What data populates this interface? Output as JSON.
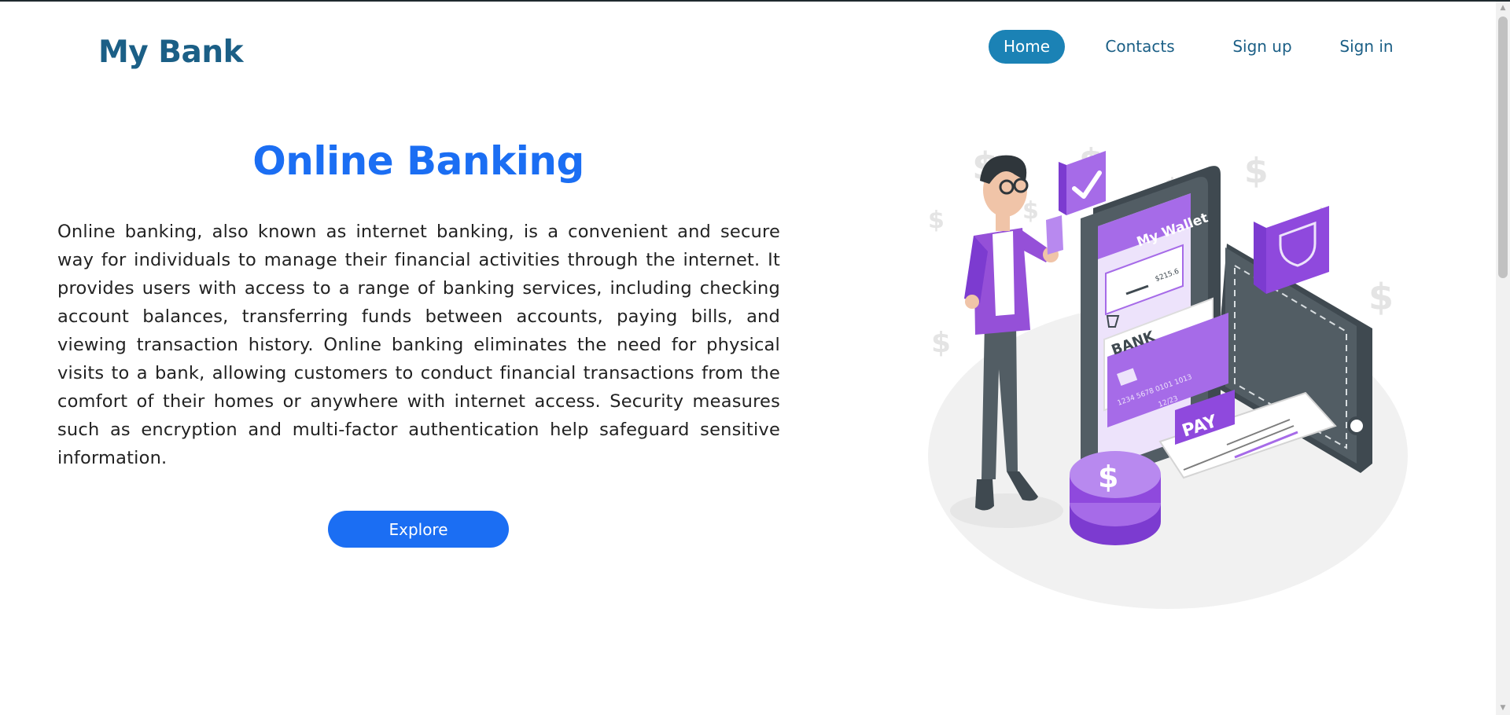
{
  "logo": "My Bank",
  "nav": {
    "items": [
      {
        "label": "Home",
        "active": true
      },
      {
        "label": "Contacts",
        "active": false
      },
      {
        "label": "Sign up",
        "active": false
      },
      {
        "label": "Sign in",
        "active": false
      }
    ]
  },
  "hero": {
    "title": "Online Banking",
    "text": "Online banking, also known as internet banking, is a convenient and secure way for individuals to manage their financial activities through the internet. It provides users with access to a range of banking services, including checking account balances, transferring funds between accounts, paying bills, and viewing transaction history. Online banking eliminates the need for physical visits to a bank, allowing customers to conduct financial transactions from the comfort of their homes or anywhere with internet access. Security measures such as encryption and multi-factor authentication help safeguard sensitive information.",
    "button": "Explore"
  },
  "illustration": {
    "wallet_label": "My Wallet",
    "balance": "$215.6",
    "card_label": "BANK",
    "card_number": "1234 5678 0101 1013",
    "card_expiry": "12/23",
    "pay_label": "PAY",
    "coin_symbol": "$"
  },
  "colors": {
    "brand": "#1b5f86",
    "accent": "#1b6ef3",
    "nav_active": "#1b82b5",
    "illustration_purple": "#a66be8"
  }
}
